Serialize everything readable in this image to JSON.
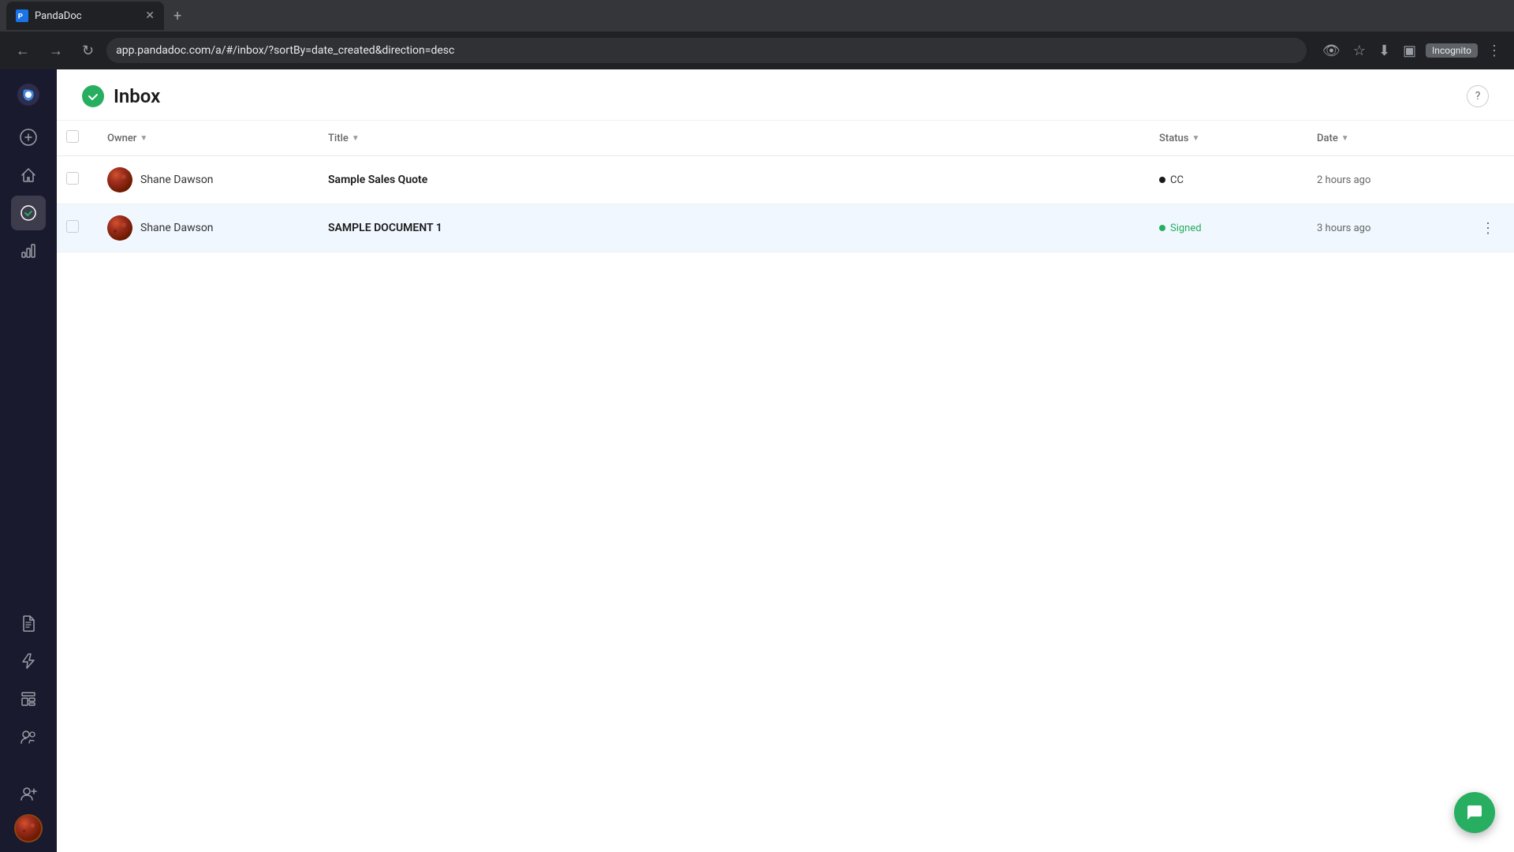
{
  "browser": {
    "url": "app.pandadoc.com/a/#/inbox/?sortBy=date_created&direction=desc",
    "tab_title": "PandaDoc",
    "new_tab_label": "+",
    "incognito_label": "Incognito"
  },
  "sidebar": {
    "logo_alt": "PandaDoc logo",
    "items": [
      {
        "id": "home",
        "icon": "⊕",
        "label": "Create New"
      },
      {
        "id": "dashboard",
        "icon": "⌂",
        "label": "Dashboard"
      },
      {
        "id": "inbox",
        "icon": "✓",
        "label": "Inbox",
        "active": true
      },
      {
        "id": "analytics",
        "icon": "⊞",
        "label": "Analytics"
      },
      {
        "id": "documents",
        "icon": "📄",
        "label": "Documents"
      },
      {
        "id": "automation",
        "icon": "⚡",
        "label": "Automation"
      },
      {
        "id": "templates",
        "icon": "☰",
        "label": "Templates"
      },
      {
        "id": "contacts",
        "icon": "👥",
        "label": "Contacts"
      }
    ],
    "bottom_items": [
      {
        "id": "add-user",
        "icon": "👤+",
        "label": "Add User"
      }
    ]
  },
  "header": {
    "title": "Inbox",
    "help_label": "?"
  },
  "table": {
    "columns": [
      {
        "id": "select",
        "label": ""
      },
      {
        "id": "owner",
        "label": "Owner"
      },
      {
        "id": "title",
        "label": "Title"
      },
      {
        "id": "status",
        "label": "Status"
      },
      {
        "id": "date",
        "label": "Date"
      }
    ],
    "rows": [
      {
        "id": "row-1",
        "owner": "Shane Dawson",
        "title": "Sample Sales Quote",
        "status_type": "cc",
        "status_label": "CC",
        "status_color": "black",
        "date": "2 hours ago",
        "highlighted": false
      },
      {
        "id": "row-2",
        "owner": "Shane Dawson",
        "title": "SAMPLE DOCUMENT 1",
        "status_type": "signed",
        "status_label": "Signed",
        "status_color": "green",
        "date": "3 hours ago",
        "highlighted": true
      }
    ]
  },
  "chat": {
    "icon_label": "💬",
    "close_label": "✕"
  }
}
